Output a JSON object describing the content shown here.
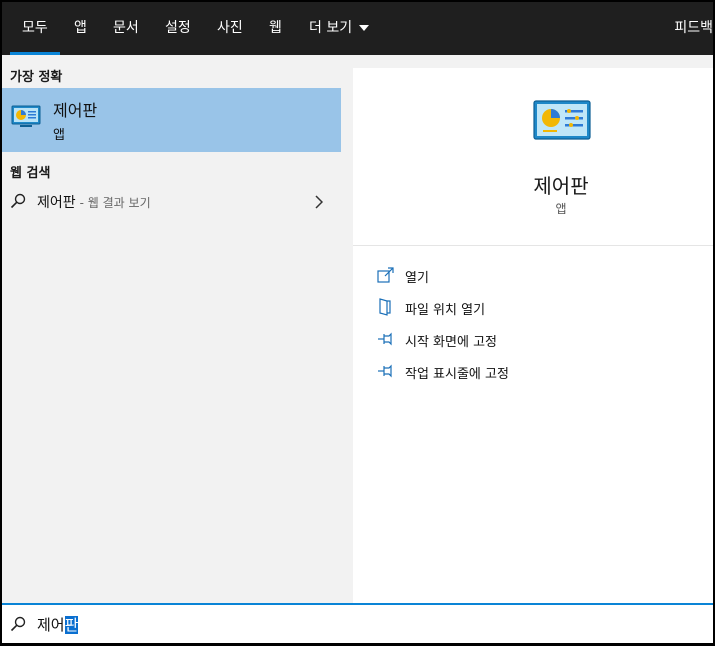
{
  "tabs": [
    {
      "label": "모두",
      "active": true
    },
    {
      "label": "앱"
    },
    {
      "label": "문서"
    },
    {
      "label": "설정"
    },
    {
      "label": "사진"
    },
    {
      "label": "웹"
    },
    {
      "label": "더 보기"
    }
  ],
  "feedback_label": "피드백",
  "left": {
    "best_match_heading": "가장 정확",
    "best_match": {
      "title": "제어판",
      "subtitle": "앱",
      "icon": "control-panel-icon"
    },
    "web_heading": "웹 검색",
    "web_result": {
      "query": "제어판",
      "hint": "- 웹 결과 보기"
    }
  },
  "detail": {
    "title": "제어판",
    "subtitle": "앱",
    "actions": [
      {
        "label": "열기",
        "icon": "open-icon"
      },
      {
        "label": "파일 위치 열기",
        "icon": "file-location-icon"
      },
      {
        "label": "시작 화면에 고정",
        "icon": "pin-icon"
      },
      {
        "label": "작업 표시줄에 고정",
        "icon": "pin-icon"
      }
    ]
  },
  "search": {
    "typed": "제어",
    "selected": "판"
  },
  "colors": {
    "accent": "#0a84d6",
    "highlight": "#99c4e8",
    "tabbar": "#1f1f1f"
  }
}
